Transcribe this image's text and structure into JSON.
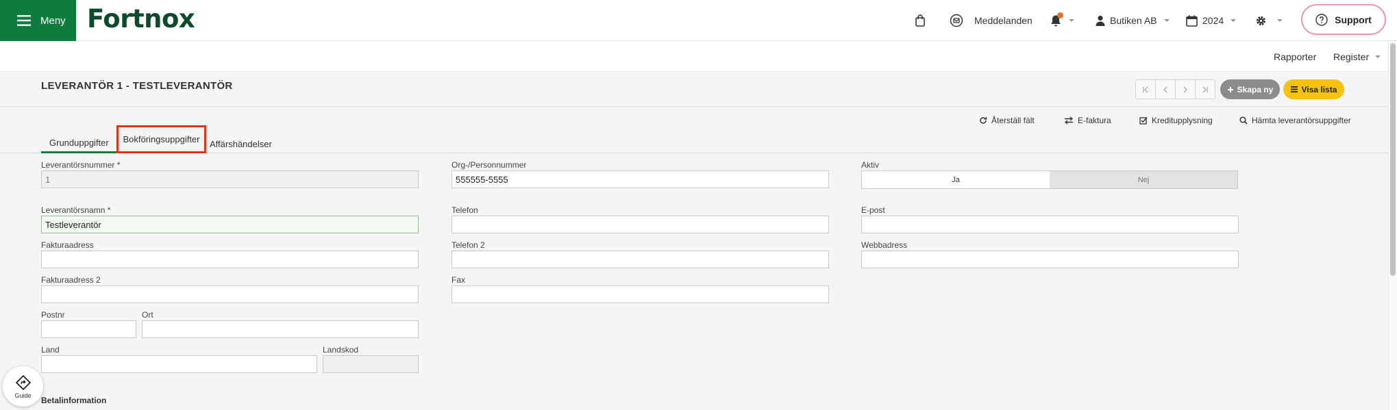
{
  "topbar": {
    "menu_label": "Meny",
    "logo": "Fortnox",
    "messages_label": "Meddelanden",
    "company_label": "Butiken AB",
    "year_label": "2024",
    "support_label": "Support"
  },
  "subbar": {
    "reports_label": "Rapporter",
    "register_label": "Register"
  },
  "page": {
    "title": "LEVERANTÖR 1 - TESTLEVERANTÖR",
    "new_label": "Skapa ny",
    "list_label": "Visa lista"
  },
  "actions": {
    "reset": "Återställ fält",
    "einvoice": "E-faktura",
    "credit": "Kreditupplysning",
    "fetch": "Hämta leverantörsuppgifter"
  },
  "tabs": {
    "basic": "Grunduppgifter",
    "accounting": "Bokföringsuppgifter",
    "transactions": "Affärshändelser"
  },
  "form": {
    "supplier_number": {
      "label": "Leverantörsnummer *",
      "value": "1"
    },
    "supplier_name": {
      "label": "Leverantörsnamn *",
      "value": "Testleverantör"
    },
    "invoice_address": {
      "label": "Fakturaadress",
      "value": ""
    },
    "invoice_address2": {
      "label": "Fakturaadress 2",
      "value": ""
    },
    "postal_code": {
      "label": "Postnr",
      "value": ""
    },
    "city": {
      "label": "Ort",
      "value": ""
    },
    "country": {
      "label": "Land",
      "value": ""
    },
    "country_code": {
      "label": "Landskod",
      "value": ""
    },
    "org_number": {
      "label": "Org-/Personnummer",
      "value": "555555-5555"
    },
    "phone": {
      "label": "Telefon",
      "value": ""
    },
    "phone2": {
      "label": "Telefon 2",
      "value": ""
    },
    "fax": {
      "label": "Fax",
      "value": ""
    },
    "active": {
      "label": "Aktiv",
      "yes": "Ja",
      "no": "Nej",
      "selected": "Ja"
    },
    "email": {
      "label": "E-post",
      "value": ""
    },
    "website": {
      "label": "Webbadress",
      "value": ""
    }
  },
  "section": {
    "payment_info": "Betalinformation"
  },
  "guide": {
    "label": "Guide"
  },
  "colors": {
    "brand_green": "#0e7b3f",
    "highlight_red": "#e0321d",
    "list_yellow": "#f7c10f",
    "support_pink": "#e796b4"
  }
}
